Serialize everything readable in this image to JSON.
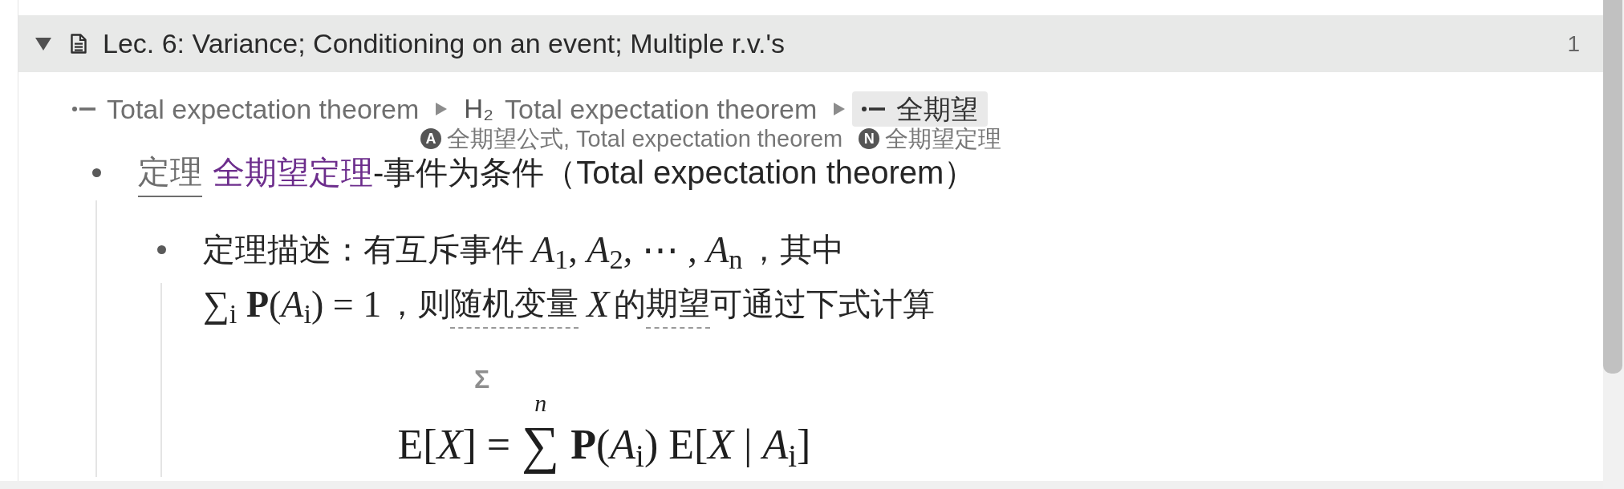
{
  "section": {
    "title": "Lec. 6: Variance; Conditioning on an event; Multiple r.v.'s",
    "expanded": true,
    "count": "1"
  },
  "breadcrumb": {
    "items": [
      {
        "kind": "list",
        "label": "Total expectation theorem",
        "selected": false
      },
      {
        "kind": "heading",
        "marker": "H₂",
        "label": "Total expectation theorem",
        "selected": false
      },
      {
        "kind": "list",
        "label": "全期望",
        "selected": true
      }
    ],
    "aliases": [
      {
        "badge": "A",
        "text": "全期望公式, Total expectation theorem"
      },
      {
        "badge": "N",
        "text": "全期望定理"
      }
    ]
  },
  "outline": [
    {
      "kind": "bullet",
      "lines": [
        [
          {
            "kind": "tag",
            "text": "定理"
          },
          {
            "kind": "link",
            "text": "全期望定理"
          },
          {
            "kind": "text",
            "text": "-事件为条件（Total expectation theorem）"
          }
        ]
      ],
      "children": [
        {
          "kind": "bullet",
          "lines": [
            [
              {
                "kind": "text",
                "text": "定理描述：有互斥事件"
              },
              {
                "kind": "math",
                "text": "*A*$_{1}$, *A*$_{2}$, ⋯ , *A*$_{n}$"
              },
              {
                "kind": "text",
                "text": "，其中"
              }
            ],
            [
              {
                "kind": "math",
                "text": "∑$_{i}$ **P**(*A*$_{i}$) = 1"
              },
              {
                "kind": "text",
                "text": "，则"
              },
              {
                "kind": "term",
                "text": "随机变量"
              },
              {
                "kind": "math",
                "text": "*X*"
              },
              {
                "kind": "text",
                "text": "的"
              },
              {
                "kind": "term",
                "text": "期望"
              },
              {
                "kind": "text",
                "text": "可通过下式计算"
              }
            ]
          ],
          "children": [
            {
              "kind": "formula",
              "marker": "Σ",
              "lhs": "E[*X*] =",
              "operator": "∑",
              "upper": "*n*",
              "rhs": "**P**(*A*$_{i}$) E[*X* | *A*$_{i}$]"
            }
          ]
        }
      ]
    }
  ]
}
